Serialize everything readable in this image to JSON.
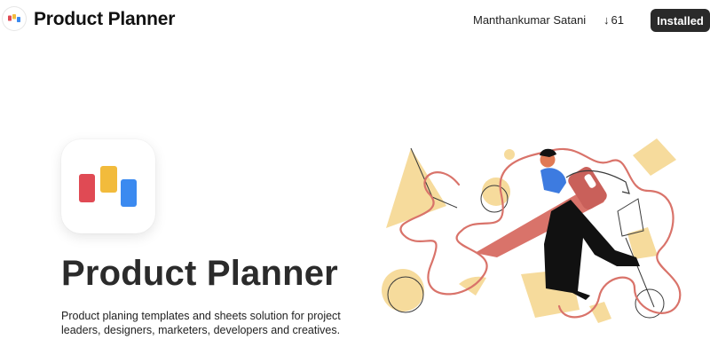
{
  "header": {
    "app_title": "Product Planner",
    "author": "Manthankumar Satani",
    "downloads": "61",
    "downloads_arrow": "↓",
    "install_button": "Installed"
  },
  "hero": {
    "title": "Product Planner",
    "description": "Product planing templates and sheets solution for project leaders, designers, marketers, developers and creatives."
  },
  "icons": {
    "app_icon": "product-planner-logo-icon",
    "download_icon": "arrow-down-icon",
    "illustration": "person-riding-pencil-illustration"
  },
  "colors": {
    "logo_red": "#E04A54",
    "logo_yellow": "#F2BB3C",
    "logo_blue": "#3B8AF0",
    "button_bg": "#2A2A2A",
    "pencil": "#D9736A",
    "shape_yellow": "#F6DB9C",
    "shirt_blue": "#3D7BE0"
  }
}
